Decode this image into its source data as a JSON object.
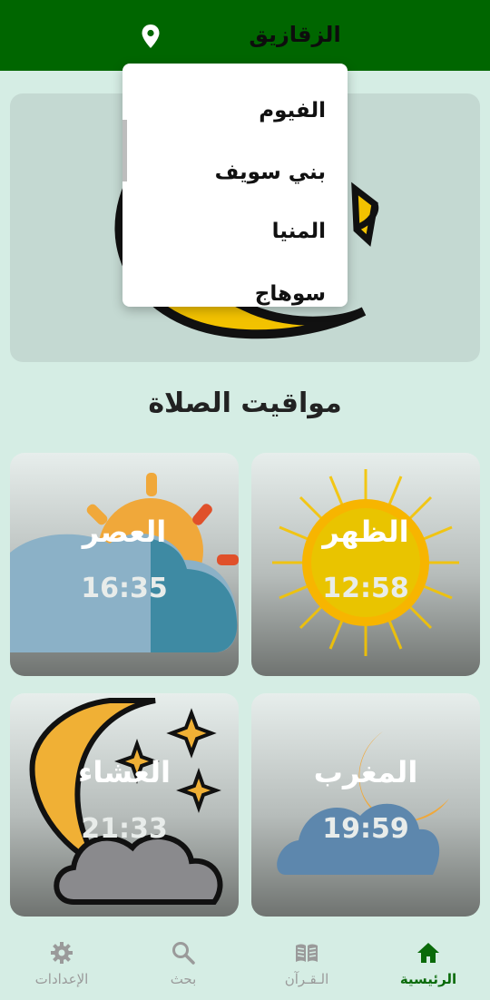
{
  "app_bar": {
    "city": "الزقازيق",
    "location_icon": "location-pin-icon",
    "background_color": "#006600"
  },
  "city_dropdown": {
    "options": [
      "الفيوم",
      "بني سويف",
      "المنيا",
      "سوهاج"
    ]
  },
  "section_title": "مواقيت الصلاة",
  "prayers": [
    {
      "name": "الظهر",
      "time": "12:58",
      "icon": "sun-icon"
    },
    {
      "name": "العصر",
      "time": "16:35",
      "icon": "sun-behind-cloud-icon"
    },
    {
      "name": "المغرب",
      "time": "19:59",
      "icon": "moon-behind-cloud-icon"
    },
    {
      "name": "العشاء",
      "time": "21:33",
      "icon": "moon-stars-cloud-icon"
    }
  ],
  "bottom_nav": {
    "items": [
      {
        "label": "الرئيسية",
        "icon": "home-icon",
        "active": true
      },
      {
        "label": "الـقـرآن",
        "icon": "book-icon",
        "active": false
      },
      {
        "label": "بحث",
        "icon": "search-icon",
        "active": false
      },
      {
        "label": "الإعدادات",
        "icon": "gear-icon",
        "active": false
      }
    ],
    "active_color": "#0a6a0a",
    "inactive_color": "#9a9a9a"
  }
}
